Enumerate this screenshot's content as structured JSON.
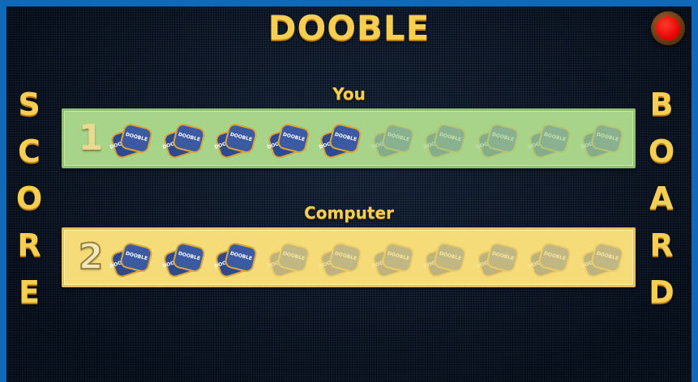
{
  "title": "DOOBLE",
  "side_left_letters": [
    "S",
    "C",
    "O",
    "R",
    "E"
  ],
  "side_right_letters": [
    "B",
    "O",
    "A",
    "R",
    "D"
  ],
  "players": [
    {
      "name": "You",
      "score": "1",
      "active_cards": 5,
      "total_cards": 10,
      "card_label": "DOOBLE"
    },
    {
      "name": "Computer",
      "score": "2",
      "active_cards": 3,
      "total_cards": 10,
      "card_label": "DOOBLE"
    }
  ],
  "colors": {
    "title": "#f6cf52",
    "you_panel": "#a8d48a",
    "computer_panel": "#f6dc78",
    "card_face": "#3b5aa2",
    "card_border": "#d9a43a",
    "record_button": "#e00000"
  },
  "icons": {
    "record_button": "record-icon",
    "card": "dooble-card-icon"
  }
}
